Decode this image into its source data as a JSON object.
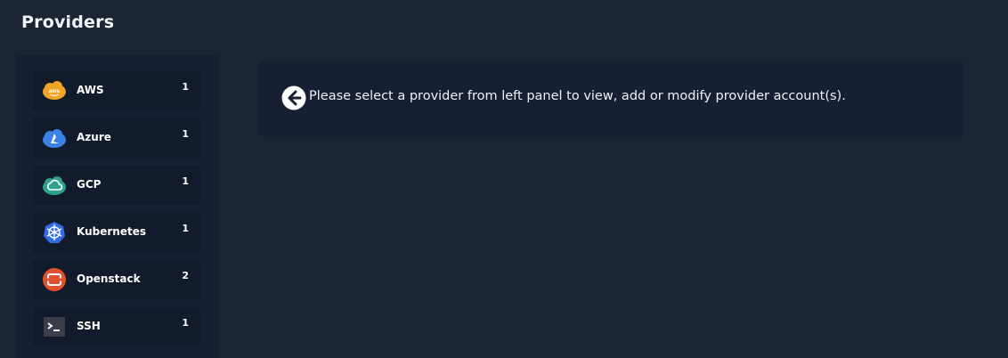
{
  "page": {
    "title": "Providers"
  },
  "providers": [
    {
      "name": "AWS",
      "count": "1",
      "icon": "aws-icon",
      "color": "#f0a526"
    },
    {
      "name": "Azure",
      "count": "1",
      "icon": "azure-icon",
      "color": "#3b82e6"
    },
    {
      "name": "GCP",
      "count": "1",
      "icon": "gcp-icon",
      "color": "#2ea28c"
    },
    {
      "name": "Kubernetes",
      "count": "1",
      "icon": "kubernetes-icon",
      "color": "#326ce5"
    },
    {
      "name": "Openstack",
      "count": "2",
      "icon": "openstack-icon",
      "color": "#e2502e"
    },
    {
      "name": "SSH",
      "count": "1",
      "icon": "terminal-icon",
      "color": "#3b3e48"
    }
  ],
  "message": {
    "text": "Please select a provider from left panel to view, add or modify provider account(s).",
    "icon": "arrow-left-circle-icon"
  },
  "colors": {
    "background": "#1c2534",
    "panel": "#162032",
    "item": "#121b2b"
  }
}
